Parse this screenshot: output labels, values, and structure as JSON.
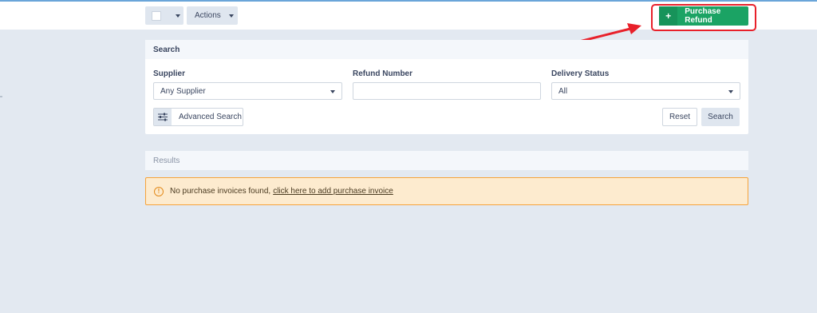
{
  "toolbar": {
    "actions_label": "Actions",
    "purchase_refund_label": "Purchase Refund",
    "purchase_refund_icon": "plus-icon",
    "accent_color": "#1ba364",
    "highlight_color": "#e8202a"
  },
  "search_panel": {
    "title": "Search",
    "supplier": {
      "label": "Supplier",
      "value": "Any Supplier"
    },
    "refund_number": {
      "label": "Refund Number",
      "value": "",
      "placeholder": ""
    },
    "delivery_status": {
      "label": "Delivery Status",
      "value": "All"
    },
    "advanced_search_label": "Advanced Search",
    "advanced_search_icon": "sliders-icon",
    "reset_label": "Reset",
    "search_label": "Search"
  },
  "results": {
    "title": "Results",
    "notice_text": "No purchase invoices found,",
    "notice_link": "click here to add purchase invoice",
    "notice_icon": "warning-icon"
  }
}
